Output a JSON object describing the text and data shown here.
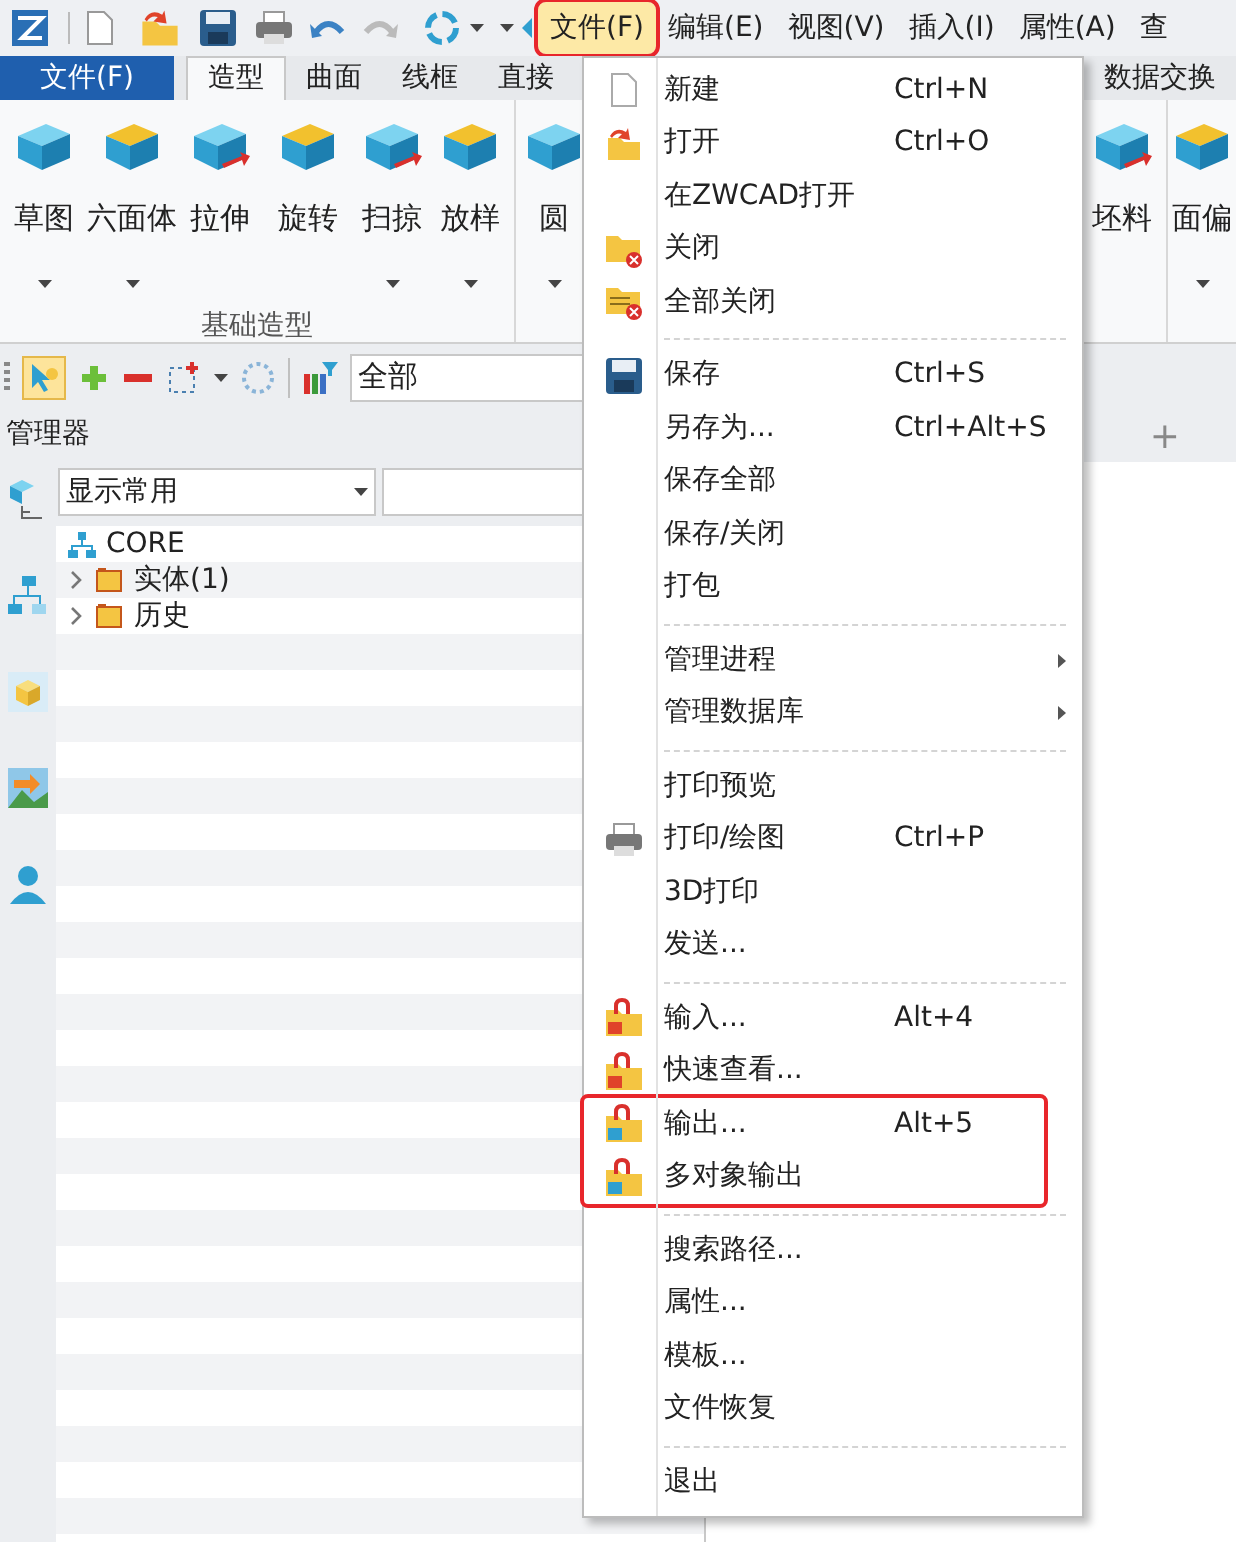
{
  "menu_bar": [
    {
      "label": "文件(F)",
      "selected": true,
      "marked": true
    },
    {
      "label": "编辑(E)",
      "selected": false,
      "marked": false
    },
    {
      "label": "视图(V)",
      "selected": false,
      "marked": false
    },
    {
      "label": "插入(I)",
      "selected": false,
      "marked": false
    },
    {
      "label": "属性(A)",
      "selected": false,
      "marked": false
    },
    {
      "label": "查",
      "selected": false,
      "marked": false
    }
  ],
  "ribbon_tabs": [
    {
      "label": "文件(F)",
      "kind": "file"
    },
    {
      "label": "造型",
      "kind": "tab",
      "selected": true
    },
    {
      "label": "曲面",
      "kind": "tab",
      "selected": false
    },
    {
      "label": "线框",
      "kind": "tab",
      "selected": false
    },
    {
      "label": "直接",
      "kind": "tab",
      "selected": false
    }
  ],
  "ribbon_tabs_right": [
    {
      "label": "数据交换",
      "selected": false
    }
  ],
  "ribbon_group": {
    "label": "基础造型",
    "buttons": [
      {
        "label": "草图",
        "has_dropdown": true
      },
      {
        "label": "六面体",
        "has_dropdown": true
      },
      {
        "label": "拉伸",
        "has_dropdown": false
      },
      {
        "label": "旋转",
        "has_dropdown": false
      },
      {
        "label": "扫掠",
        "has_dropdown": true
      },
      {
        "label": "放样",
        "has_dropdown": true
      }
    ]
  },
  "ribbon_buttons_more": [
    {
      "label": "圆",
      "has_dropdown": true
    }
  ],
  "ribbon_buttons_right": [
    {
      "label": "坯料",
      "has_dropdown": false
    },
    {
      "label": "面偏",
      "has_dropdown": true
    }
  ],
  "filter": {
    "value": "全部"
  },
  "manager": {
    "title": "管理器",
    "display": "显示常用",
    "tree": [
      {
        "label": "CORE",
        "children": [
          {
            "label": "实体(1)",
            "expanded": false
          },
          {
            "label": "历史",
            "expanded": false
          }
        ]
      }
    ]
  },
  "file_menu": [
    {
      "kind": "item",
      "label": "新建",
      "shortcut": "Ctrl+N",
      "marked": false
    },
    {
      "kind": "item",
      "label": "打开",
      "shortcut": "Ctrl+O",
      "marked": false
    },
    {
      "kind": "item",
      "label": "在ZWCAD打开",
      "marked": false
    },
    {
      "kind": "item",
      "label": "关闭",
      "marked": false
    },
    {
      "kind": "item",
      "label": "全部关闭",
      "marked": false
    },
    {
      "kind": "separator"
    },
    {
      "kind": "item",
      "label": "保存",
      "shortcut": "Ctrl+S",
      "marked": false
    },
    {
      "kind": "item",
      "label": "另存为...",
      "shortcut": "Ctrl+Alt+S",
      "marked": false
    },
    {
      "kind": "item",
      "label": "保存全部",
      "marked": false
    },
    {
      "kind": "item",
      "label": "保存/关闭",
      "marked": false
    },
    {
      "kind": "item",
      "label": "打包",
      "marked": false
    },
    {
      "kind": "separator"
    },
    {
      "kind": "submenu",
      "label": "管理进程",
      "marked": false
    },
    {
      "kind": "submenu",
      "label": "管理数据库",
      "marked": false
    },
    {
      "kind": "separator"
    },
    {
      "kind": "item",
      "label": "打印预览",
      "marked": false
    },
    {
      "kind": "item",
      "label": "打印/绘图",
      "shortcut": "Ctrl+P",
      "marked": false
    },
    {
      "kind": "item",
      "label": "3D打印",
      "marked": false
    },
    {
      "kind": "item",
      "label": "发送...",
      "marked": false
    },
    {
      "kind": "separator"
    },
    {
      "kind": "item",
      "label": "输入...",
      "shortcut": "Alt+4",
      "marked": false
    },
    {
      "kind": "item",
      "label": "快速查看...",
      "marked": false
    },
    {
      "kind": "item",
      "label": "输出...",
      "shortcut": "Alt+5",
      "marked": true
    },
    {
      "kind": "item",
      "label": "多对象输出",
      "marked": true
    },
    {
      "kind": "separator"
    },
    {
      "kind": "item",
      "label": "搜索路径...",
      "marked": false
    },
    {
      "kind": "item",
      "label": "属性...",
      "marked": false
    },
    {
      "kind": "item",
      "label": "模板...",
      "marked": false
    },
    {
      "kind": "item",
      "label": "文件恢复",
      "marked": false
    },
    {
      "kind": "separator"
    },
    {
      "kind": "item",
      "label": "退出",
      "marked": false
    }
  ],
  "add_tab": "+"
}
